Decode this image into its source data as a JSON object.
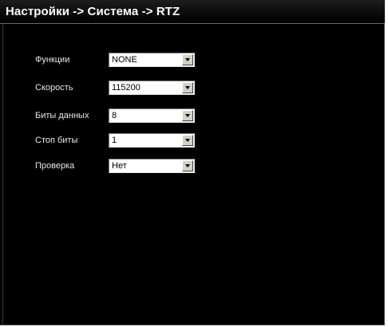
{
  "window": {
    "title": "Настройки -> Система -> RTZ"
  },
  "form": {
    "fields": [
      {
        "label": "Функции",
        "value": "NONE"
      },
      {
        "label": "Скорость",
        "value": "115200"
      },
      {
        "label": "Биты данных",
        "value": "8"
      },
      {
        "label": "Стоп биты",
        "value": "1"
      },
      {
        "label": "Проверка",
        "value": "Нет"
      }
    ]
  },
  "colors": {
    "background": "#000000",
    "text": "#e8e8e8",
    "control_bg": "#ffffff",
    "button_face": "#d4d0c8"
  },
  "icons": {
    "dropdown": "chevron-down-icon"
  }
}
